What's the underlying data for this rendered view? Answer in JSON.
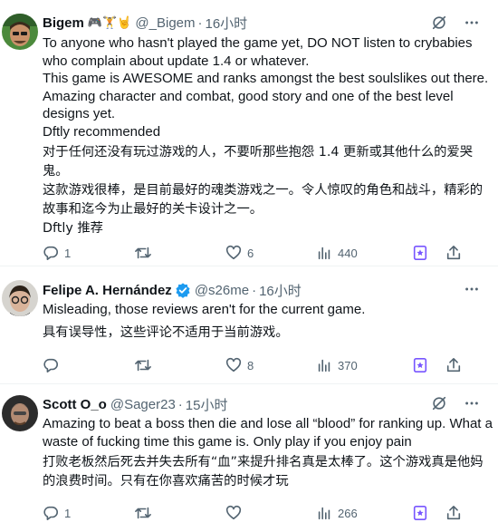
{
  "tweets": [
    {
      "name": "Bigem",
      "name_emoji": "🎮🏋🤘",
      "handle": "@_Bigem",
      "sep": "·",
      "time": "16小时",
      "text": "To anyone who hasn't played the game yet, DO NOT listen to crybabies who complain about update 1.4 or whatever.\nThis game is AWESOME and ranks amongst the best soulslikes out there. Amazing character and combat, good story and one of the best level designs yet.\nDftly recommended",
      "translation": "对于任何还没有玩过游戏的人，不要听那些抱怨 1.4 更新或其他什么的爱哭鬼。\n这款游戏很棒，是目前最好的魂类游戏之一。令人惊叹的角色和战斗，精彩的故事和迄今为止最好的关卡设计之一。\nDftly 推荐",
      "replies": "1",
      "retweets": "",
      "likes": "6",
      "views": "440"
    },
    {
      "name": "Felipe A. Hernández",
      "verified": true,
      "handle": "@s26me",
      "sep": "·",
      "time": "16小时",
      "text": "Misleading, those reviews aren't for the current game.",
      "translation": "具有误导性，这些评论不适用于当前游戏。",
      "replies": "",
      "retweets": "",
      "likes": "8",
      "views": "370"
    },
    {
      "name": "Scott O_o",
      "handle": "@Sager23",
      "sep": "·",
      "time": "15小时",
      "text": "Amazing to beat a boss then die and lose all “blood” for ranking up. What a waste of fucking time this game is. Only play if you enjoy pain",
      "translation": "打败老板然后死去并失去所有“血”来提升排名真是太棒了。这个游戏真是他妈的浪费时间。只有在你喜欢痛苦的时候才玩",
      "replies": "1",
      "retweets": "",
      "likes": "",
      "views": "266"
    }
  ],
  "colors": {
    "text": "#0f1419",
    "muted": "#536471",
    "verified": "#1d9bf0",
    "divider": "#eff3f4",
    "bookmark": "#7856ff"
  }
}
